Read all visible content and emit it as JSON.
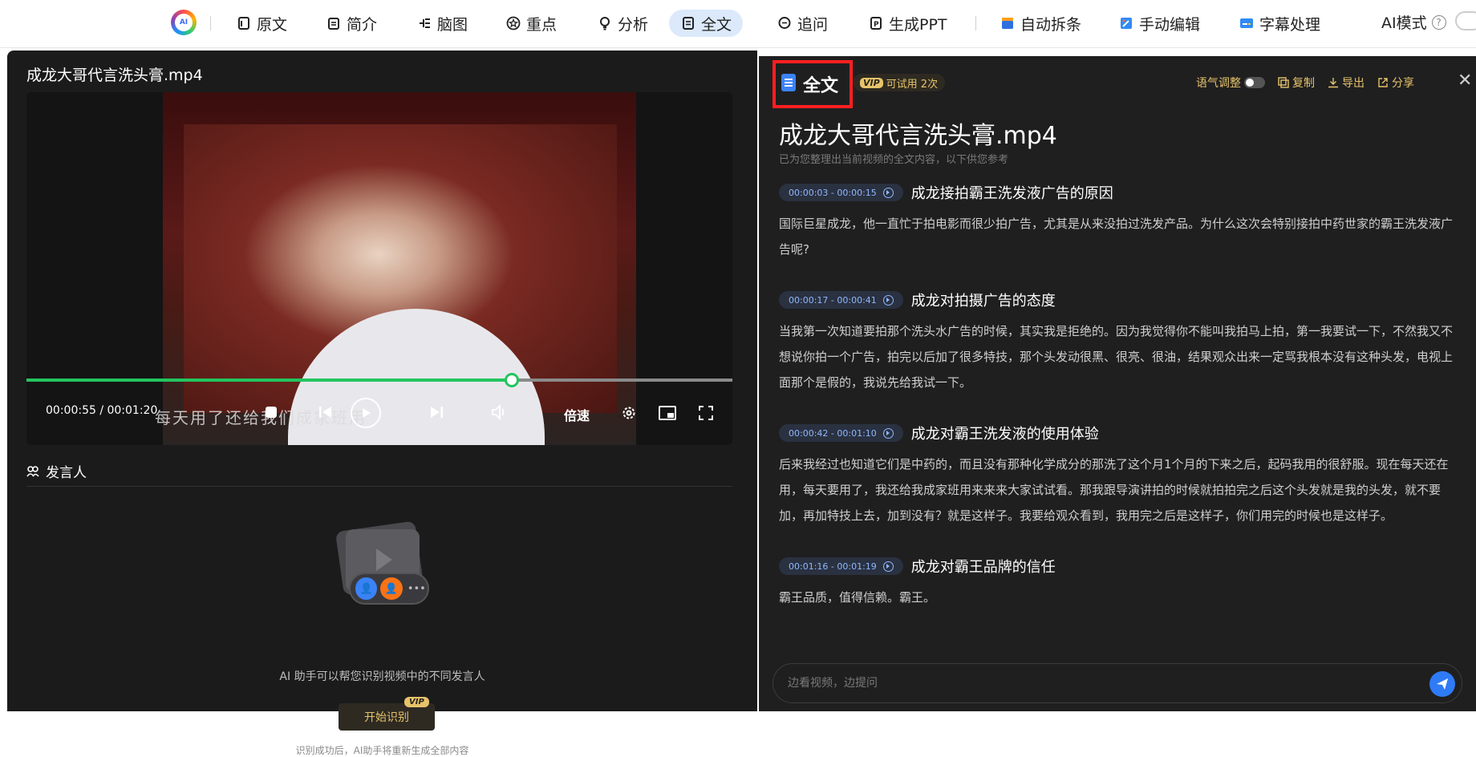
{
  "toolbar": {
    "logo_text": "AI",
    "items": [
      {
        "label": "原文",
        "icon": "doc-outline-icon"
      },
      {
        "label": "简介",
        "icon": "clipboard-icon"
      },
      {
        "label": "脑图",
        "icon": "mindmap-icon"
      },
      {
        "label": "重点",
        "icon": "star-icon"
      },
      {
        "label": "分析",
        "icon": "bulb-icon"
      },
      {
        "label": "全文",
        "icon": "document-icon",
        "active": true
      },
      {
        "label": "追问",
        "icon": "chat-icon"
      },
      {
        "label": "生成PPT",
        "icon": "ppt-icon"
      },
      {
        "label": "自动拆条",
        "icon": "clapper-icon"
      },
      {
        "label": "手动编辑",
        "icon": "edit-icon"
      },
      {
        "label": "字幕处理",
        "icon": "subtitle-icon"
      }
    ],
    "ai_mode_label": "AI模式",
    "active_color": "#dbe9fb"
  },
  "video": {
    "title": "成龙大哥代言洗头膏.mp4",
    "subtitle_text": "每天用了还给我们成家班用",
    "current_time": "00:00:55",
    "duration": "00:01:20",
    "time_display": "00:00:55 / 00:01:20",
    "progress_fraction": 0.6875,
    "speed_label": "倍速",
    "progress_color": "#22c55e"
  },
  "speaker": {
    "heading": "发言人",
    "description": "AI 助手可以帮您识别视频中的不同发言人",
    "start_button": "开始识别",
    "vip_tag": "VIP",
    "footer": "识别成功后，AI助手将重新生成全部内容"
  },
  "panel": {
    "label": "全文",
    "trial_badge": "可试用 2次",
    "trial_vip": "VIP",
    "tone_label": "语气调整",
    "copy_label": "复制",
    "export_label": "导出",
    "share_label": "分享",
    "title": "成龙大哥代言洗头膏.mp4",
    "subtitle": "已为您整理出当前视频的全文内容，以下供您参考",
    "sections": [
      {
        "time": "00:00:03 - 00:00:15",
        "title": "成龙接拍霸王洗发液广告的原因",
        "body": "国际巨星成龙，他一直忙于拍电影而很少拍广告，尤其是从来没拍过洗发产品。为什么这次会特别接拍中药世家的霸王洗发液广告呢?"
      },
      {
        "time": "00:00:17 - 00:00:41",
        "title": "成龙对拍摄广告的态度",
        "body": "当我第一次知道要拍那个洗头水广告的时候，其实我是拒绝的。因为我觉得你不能叫我拍马上拍，第一我要试一下，不然我又不想说你拍一个广告，拍完以后加了很多特技，那个头发动很黑、很亮、很油，结果观众出来一定骂我根本没有这种头发，电视上面那个是假的，我说先给我试一下。"
      },
      {
        "time": "00:00:42 - 00:01:10",
        "title": "成龙对霸王洗发液的使用体验",
        "body": "后来我经过也知道它们是中药的，而且没有那种化学成分的那洗了这个月1个月的下来之后，起码我用的很舒服。现在每天还在用，每天要用了，我还给我成家班用来来来大家试试看。那我跟导演讲拍的时候就拍拍完之后这个头发就是我的头发，就不要加，再加特技上去，加到没有？就是这样子。我要给观众看到，我用完之后是这样子，你们用完的时候也是这样子。"
      },
      {
        "time": "00:01:16 - 00:01:19",
        "title": "成龙对霸王品牌的信任",
        "body": "霸王品质，值得信赖。霸王。"
      }
    ],
    "ask_placeholder": "边看视频，边提问",
    "highlight_color": "#ff1f1f"
  }
}
